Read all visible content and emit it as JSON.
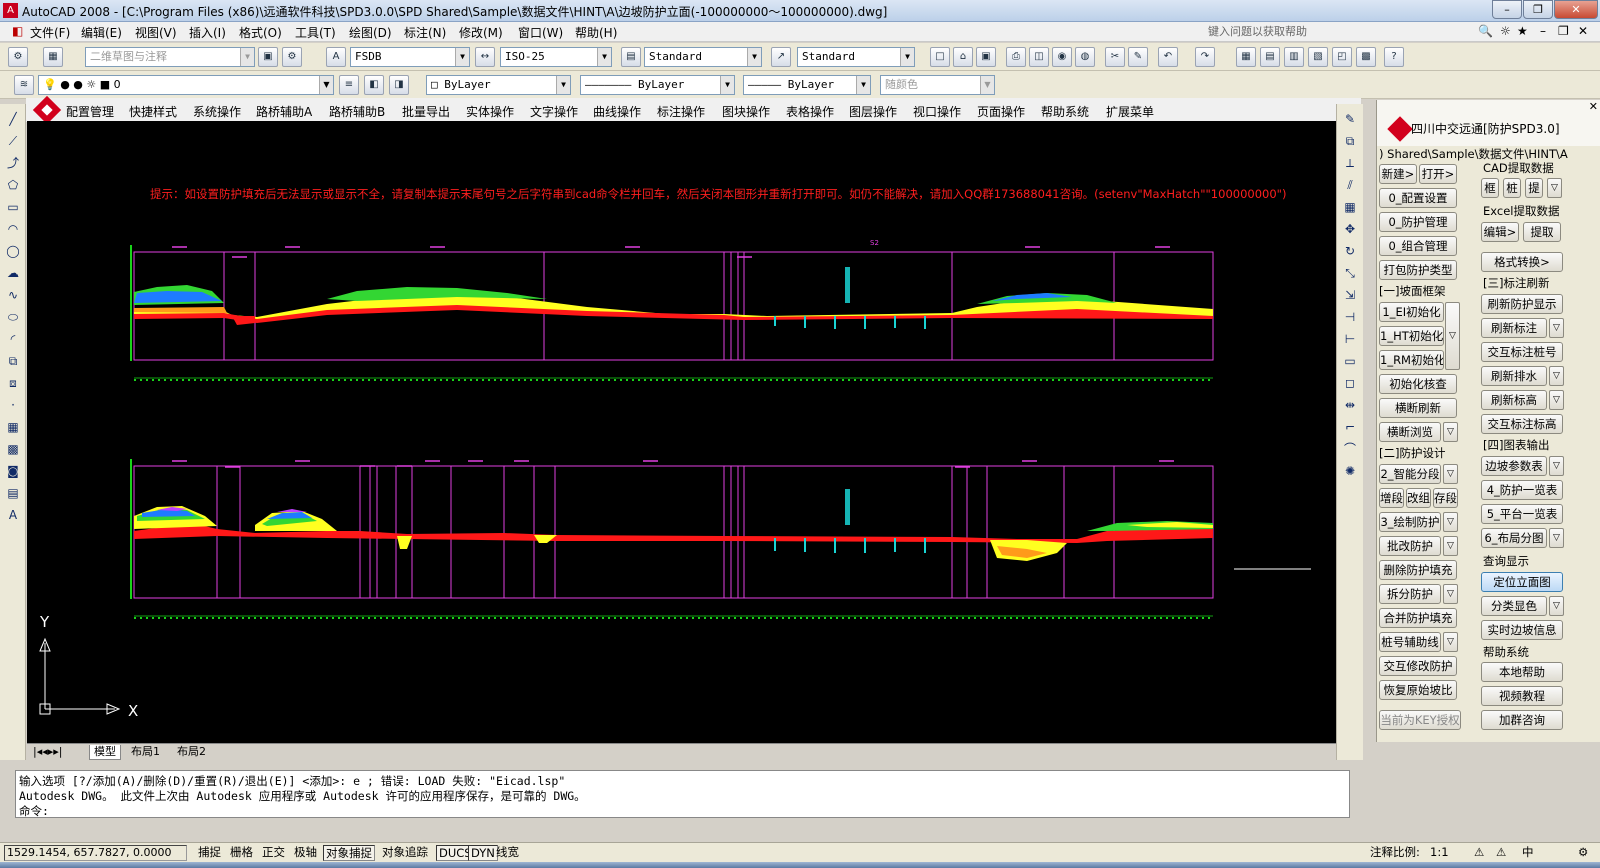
{
  "window": {
    "title": "AutoCAD 2008 - [C:\\Program Files (x86)\\远通软件科技\\SPD3.0.0\\SPD Shared\\Sample\\数据文件\\HINT\\A\\边坡防护立面(-100000000～100000000).dwg]"
  },
  "menu": [
    "文件(F)",
    "编辑(E)",
    "视图(V)",
    "插入(I)",
    "格式(O)",
    "工具(T)",
    "绘图(D)",
    "标注(N)",
    "修改(M)",
    "窗口(W)",
    "帮助(H)"
  ],
  "help_search": "键入问题以获取帮助",
  "toolbar1": {
    "workspace": "二维草图与注释",
    "text_style": "FSDB",
    "dim_style": "ISO-25",
    "table_style": "Standard",
    "ml_style": "Standard"
  },
  "toolbar2": {
    "layer": "0",
    "color": "ByLayer",
    "linetype": "ByLayer",
    "lineweight": "ByLayer",
    "plotstyle": "随颜色"
  },
  "spd_menu": [
    "配置管理",
    "快捷样式",
    "系统操作",
    "路桥辅助A",
    "路桥辅助B",
    "批量导出",
    "实体操作",
    "文字操作",
    "曲线操作",
    "标注操作",
    "图块操作",
    "表格操作",
    "图层操作",
    "视口操作",
    "页面操作",
    "帮助系统",
    "扩展菜单"
  ],
  "drawing": {
    "hint": "提示：如设置防护填充后无法显示或显示不全，请复制本提示末尾句号之后字符串到cad命令栏并回车，然后关闭本图形并重新打开即可。如仍不能解决，请加入QQ群173688041咨询。(setenv\"MaxHatch\"\"100000000\")",
    "label_top": "S2",
    "axis_y": "Y",
    "axis_x": "X"
  },
  "layout_tabs": [
    "模型",
    "布局1",
    "布局2"
  ],
  "command": {
    "line1": "输入选项 [?/添加(A)/删除(D)/重置(R)/退出(E)] <添加>:  e ; 错误: LOAD 失败: \"Eicad.lsp\"",
    "line2": "Autodesk DWG。  此文件上次由 Autodesk 应用程序或 Autodesk 许可的应用程序保存，是可靠的 DWG。",
    "prompt": "命令:"
  },
  "status": {
    "coords": "1529.1454, 657.7827, 0.0000",
    "buttons": [
      "捕捉",
      "栅格",
      "正交",
      "极轴",
      "对象捕捉",
      "对象追踪",
      "DUCS",
      "DYN",
      "线宽"
    ],
    "annotation_scale_label": "注释比例:",
    "annotation_scale": "1:1"
  },
  "panel": {
    "title": "四川中交远通[防护SPD3.0]",
    "path": ") Shared\\Sample\\数据文件\\HINT\\A",
    "new": "新建>",
    "open": "打开>",
    "cad_extract": "CAD提取数据",
    "frame": "框",
    "pile": "桩",
    "extract_short": "提",
    "config_setup": "0_配置设置",
    "protect_manage": "0_防护管理",
    "combo_manage": "0_组合管理",
    "excel_extract": "Excel提取数据",
    "edit": "编辑>",
    "extract": "提取",
    "pack_types": "打包防护类型",
    "format_convert": "格式转换>",
    "sec1": "[一]坡面框架",
    "sec3": "[三]标注刷新",
    "init_ei": "1_EI初始化",
    "init_ht": "1_HT初始化",
    "init_rm": "1_RM初始化",
    "refresh_display": "刷新防护显示",
    "refresh_label": "刷新标注",
    "interactive_pile": "交互标注桩号",
    "refresh_drain": "刷新排水",
    "refresh_elev": "刷新标高",
    "interactive_elev": "交互标注标高",
    "init_check": "初始化核查",
    "cross_refresh": "横断刷新",
    "cross_browse": "横断浏览",
    "sec4": "[四]图表输出",
    "sec2": "[二]防护设计",
    "slope_params": "边坡参数表",
    "smart_segment": "2_智能分段",
    "add_seg": "增段",
    "modify_group": "改组",
    "save_seg": "存段",
    "protect_list": "4_防护一览表",
    "platform_list": "5_平台一览表",
    "draw_protect": "3_绘制防护",
    "layout_plan": "6_布局分图",
    "batch_modify": "批改防护",
    "query_display": "查询显示",
    "delete_fill": "删除防护填充",
    "locate_elevation": "定位立面图",
    "split_protect": "拆分防护",
    "classify_color": "分类显色",
    "merge_fill": "合并防护填充",
    "realtime_info": "实时边坡信息",
    "pile_assist": "桩号辅助线",
    "help_system": "帮助系统",
    "local_help": "本地帮助",
    "interactive_modify": "交互修改防护",
    "video_tutorial": "视频教程",
    "restore_slope": "恢复原始坡比",
    "join_group": "加群咨询",
    "key_auth": "当前为KEY授权"
  }
}
